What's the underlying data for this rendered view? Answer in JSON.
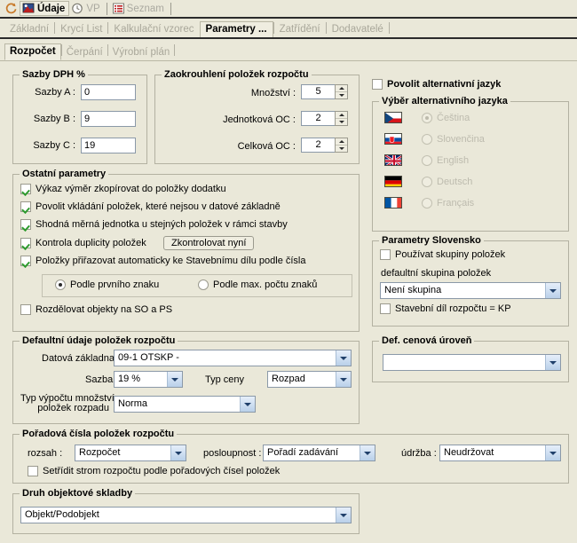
{
  "toolbar": {
    "items": [
      {
        "name": "refresh-icon",
        "label": "",
        "icon": "refresh-icon",
        "selected": false,
        "dim": false
      },
      {
        "name": "udaje",
        "label": "Údaje",
        "icon": "image-icon",
        "selected": true,
        "dim": false
      },
      {
        "name": "vp",
        "label": "VP",
        "icon": "clock-icon",
        "selected": false,
        "dim": true
      },
      {
        "name": "seznam",
        "label": "Seznam",
        "icon": "list-icon",
        "selected": false,
        "dim": true
      }
    ]
  },
  "tabs_primary": [
    {
      "label": "Základní",
      "active": false
    },
    {
      "label": "Krycí List",
      "active": false
    },
    {
      "label": "Kalkulační vzorec",
      "active": false
    },
    {
      "label": "Parametry ...",
      "active": true
    },
    {
      "label": "Zatřídění",
      "active": false
    },
    {
      "label": "Dodavatelé",
      "active": false
    }
  ],
  "tabs_secondary": [
    {
      "label": "Rozpočet",
      "active": true
    },
    {
      "label": "Čerpání",
      "active": false
    },
    {
      "label": "Výrobní plán",
      "active": false
    }
  ],
  "vat": {
    "caption": "Sazby DPH %",
    "rows": [
      {
        "label": "Sazby A :",
        "value": "0"
      },
      {
        "label": "Sazby B :",
        "value": "9"
      },
      {
        "label": "Sazby C :",
        "value": "19"
      }
    ]
  },
  "rounding": {
    "caption": "Zaokrouhlení položek rozpočtu",
    "rows": [
      {
        "label": "Množství :",
        "value": "5"
      },
      {
        "label": "Jednotková OC :",
        "value": "2"
      },
      {
        "label": "Celková OC :",
        "value": "2"
      }
    ]
  },
  "alt_language": {
    "enable_label": "Povolit alternativní jazyk",
    "enable_checked": false,
    "caption": "Výběr alternativního jazyka",
    "options": [
      {
        "label": "Čeština",
        "flag": "flag-cz",
        "selected": true
      },
      {
        "label": "Slovenčina",
        "flag": "flag-sk",
        "selected": false
      },
      {
        "label": "English",
        "flag": "flag-gb",
        "selected": false
      },
      {
        "label": "Deutsch",
        "flag": "flag-de",
        "selected": false
      },
      {
        "label": "Français",
        "flag": "flag-fr",
        "selected": false
      }
    ]
  },
  "other_params": {
    "caption": "Ostatní parametry",
    "checks": [
      {
        "label": "Výkaz výměr zkopírovat do položky dodatku",
        "checked": true
      },
      {
        "label": "Povolit vkládání položek, které nejsou v datové základně",
        "checked": true
      },
      {
        "label": "Shodná měrná jednotka u stejných položek v rámci stavby",
        "checked": true
      },
      {
        "label": "Kontrola duplicity položek",
        "checked": true
      },
      {
        "label": "Položky přiřazovat automaticky ke Stavebnímu dílu  podle čísla",
        "checked": true
      }
    ],
    "check_now_button": "Zkontrolovat nyní",
    "radios": [
      {
        "label": "Podle prvního znaku",
        "selected": true
      },
      {
        "label": "Podle max. počtu znaků",
        "selected": false
      }
    ],
    "split_label": "Rozdělovat objekty na SO a PS",
    "split_checked": false
  },
  "slovensko": {
    "caption": "Parametry Slovensko",
    "use_groups_label": "Používat skupiny položek",
    "use_groups_checked": false,
    "default_group_label": "defaultní skupina položek",
    "default_group_value": "Není skupina",
    "kp_label": "Stavební díl rozpočtu = KP",
    "kp_checked": false
  },
  "defaults": {
    "caption": "Defaultní údaje položek rozpočtu",
    "data_base_label": "Datová základna",
    "data_base_value": "09-1 OTSKP -",
    "rate_label": "Sazba",
    "rate_value": "19 %",
    "price_type_label": "Typ ceny",
    "price_type_value": "Rozpad",
    "calc_type_label_1": "Typ výpočtu množství",
    "calc_type_label_2": "položek rozpadu",
    "calc_type_value": "Norma"
  },
  "price_level": {
    "caption": "Def. cenová úroveň",
    "value": ""
  },
  "ordering": {
    "caption": "Pořadová čísla položek rozpočtu",
    "scope_label": "rozsah :",
    "scope_value": "Rozpočet",
    "sequence_label": "posloupnost :",
    "sequence_value": "Pořadí zadávání",
    "maintenance_label": "údržba :",
    "maintenance_value": "Neudržovat",
    "sort_label": "Setřídit strom rozpočtu podle pořadových čísel položek",
    "sort_checked": false
  },
  "object_structure": {
    "caption": "Druh objektové skladby",
    "value": "Objekt/Podobjekt"
  },
  "colors": {
    "background": "#EAE8D9",
    "border": "#b3b1a1",
    "check_green": "#2F9B2F",
    "disabled_text": "#a9a79a"
  }
}
